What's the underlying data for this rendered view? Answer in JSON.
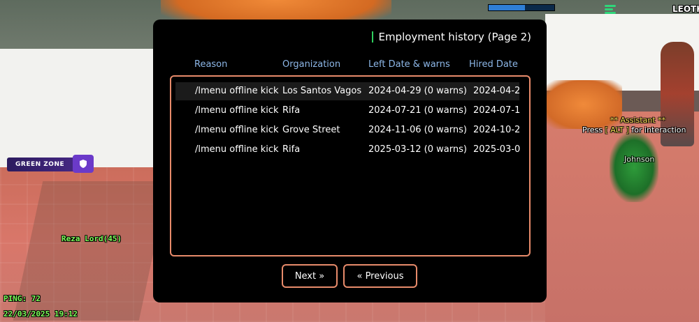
{
  "hud": {
    "player_tag": "LEOTK",
    "zone_label": "GREEN ZONE",
    "player_name": "Reza Lord(45)",
    "ping": "PING: 72",
    "datetime": "22/03/2025 19:12",
    "assistant_label": "** Assistant **",
    "interaction_prefix": "Press",
    "interaction_key": "[ ALT ]",
    "interaction_suffix": "for interaction",
    "npc_name": "Johnson",
    "health_fraction": 0.55,
    "icons": [
      "shield-icon",
      "signal-logo-icon"
    ]
  },
  "dialog": {
    "title": "Employment history (Page 2)",
    "columns": [
      "Reason",
      "Organization",
      "Left Date & warns",
      "Hired Date"
    ],
    "rows": [
      {
        "reason": "/lmenu offline kick",
        "organization": "Los Santos Vagos",
        "left": "2024-04-29 (0 warns)",
        "hired": "2024-04-2"
      },
      {
        "reason": "/lmenu offline kick",
        "organization": "Rifa",
        "left": "2024-07-21 (0 warns)",
        "hired": "2024-07-1"
      },
      {
        "reason": "/lmenu offline kick",
        "organization": "Grove Street",
        "left": "2024-11-06 (0 warns)",
        "hired": "2024-10-2"
      },
      {
        "reason": "/lmenu offline kick",
        "organization": "Rifa",
        "left": "2025-03-12 (0 warns)",
        "hired": "2025-03-0"
      }
    ],
    "selected_row": 0,
    "next_label": "Next »",
    "prev_label": "« Previous"
  },
  "colors": {
    "accent_border": "#e88b6b",
    "header_text": "#8db7e8",
    "title_mark": "#2fcf5e",
    "hud_green": "#7dff5a"
  }
}
